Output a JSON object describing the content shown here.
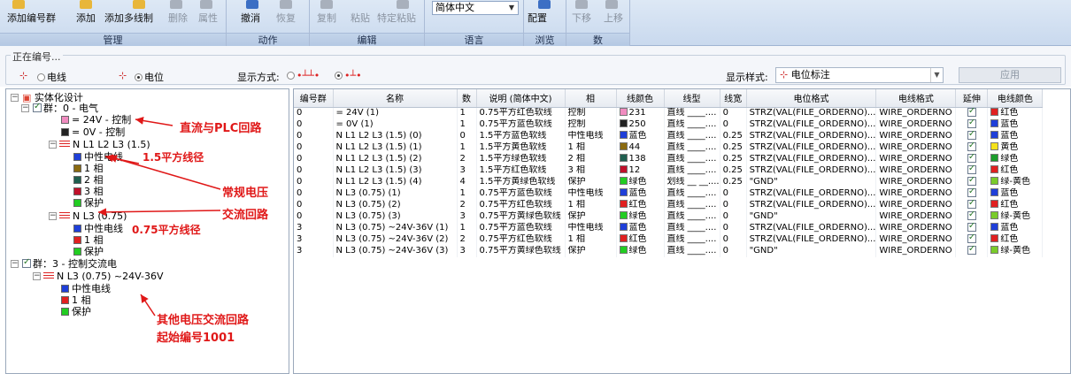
{
  "ribbon": {
    "groups": [
      {
        "label": "管理"
      },
      {
        "label": "动作"
      },
      {
        "label": "编辑"
      },
      {
        "label": "语言"
      },
      {
        "label": "浏览"
      },
      {
        "label": "数"
      }
    ],
    "buttons": {
      "add_group": "添加编号群",
      "add": "添加",
      "add_multi": "添加多线制",
      "delete": "删除",
      "props": "属性",
      "undo": "撤消",
      "redo": "恢复",
      "copy": "复制",
      "paste": "粘贴",
      "special_paste": "特定粘贴",
      "config": "配置",
      "move_down": "下移",
      "move_up": "上移"
    },
    "language_value": "简体中文"
  },
  "options": {
    "legend": "正在编号...",
    "radio_wire": "电线",
    "radio_potential": "电位",
    "display_mode_label": "显示方式:",
    "display_style_label": "显示样式:",
    "display_style_value": "电位标注",
    "apply": "应用"
  },
  "tree": {
    "root": "实体化设计",
    "g0": "群：0 - 电气",
    "p24": "= 24V - 控制",
    "p0": "= 0V - 控制",
    "l15": "N L1 L2 L3 (1.5)",
    "l15_n": "中性电线",
    "l15_1": "1 相",
    "l15_2": "2 相",
    "l15_3": "3 相",
    "l15_pe": "保护",
    "l075": "N L3 (0.75)",
    "l075_n": "中性电线",
    "l075_1": "1 相",
    "l075_pe": "保护",
    "g3": "群：3 - 控制交流电",
    "l3": "N L3 (0.75) ~24V-36V",
    "l3_n": "中性电线",
    "l3_1": "1 相",
    "l3_pe": "保护"
  },
  "annotations": {
    "a1": "直流与PLC回路",
    "a2": "1.5平方线径",
    "a3": "常规电压",
    "a4": "交流回路",
    "a5": "0.75平方线径",
    "a6": "其他电压交流回路",
    "a7": "起始编号1001"
  },
  "table": {
    "columns": [
      "编号群",
      "名称",
      "数",
      "说明 (简体中文)",
      "相",
      "线颜色",
      "线型",
      "线宽",
      "电位格式",
      "电线格式",
      "延伸",
      "电线颜色"
    ],
    "rows": [
      {
        "g": "0",
        "name": "= 24V (1)",
        "n": "1",
        "desc": "0.75平方红色软线",
        "phase": "控制",
        "wc": "231",
        "wcc": "#f08cc0",
        "lt": "直线 ____....",
        "lw": "0",
        "pf": "STRZ(VAL(FILE_ORDERNO)...",
        "wf": "WIRE_ORDERNO",
        "ext": true,
        "col": "红色",
        "colc": "#e02020"
      },
      {
        "g": "0",
        "name": "= 0V (1)",
        "n": "1",
        "desc": "0.75平方蓝色软线",
        "phase": "控制",
        "wc": "250",
        "wcc": "#222222",
        "lt": "直线 ____....",
        "lw": "0",
        "pf": "STRZ(VAL(FILE_ORDERNO)...",
        "wf": "WIRE_ORDERNO",
        "ext": true,
        "col": "蓝色",
        "colc": "#1f3fd8"
      },
      {
        "g": "0",
        "name": "N L1 L2 L3 (1.5) (0)",
        "n": "0",
        "desc": "1.5平方蓝色软线",
        "phase": "中性电线",
        "wc": "蓝色",
        "wcc": "#1f3fd8",
        "lt": "直线 ____....",
        "lw": "0.25",
        "pf": "STRZ(VAL(FILE_ORDERNO)...",
        "wf": "WIRE_ORDERNO",
        "ext": true,
        "col": "蓝色",
        "colc": "#1f3fd8"
      },
      {
        "g": "0",
        "name": "N L1 L2 L3 (1.5) (1)",
        "n": "1",
        "desc": "1.5平方黄色软线",
        "phase": "1 相",
        "wc": "44",
        "wcc": "#8a6a10",
        "lt": "直线 ____....",
        "lw": "0.25",
        "pf": "STRZ(VAL(FILE_ORDERNO)...",
        "wf": "WIRE_ORDERNO",
        "ext": true,
        "col": "黄色",
        "colc": "#f5e21a"
      },
      {
        "g": "0",
        "name": "N L1 L2 L3 (1.5) (2)",
        "n": "2",
        "desc": "1.5平方绿色软线",
        "phase": "2 相",
        "wc": "138",
        "wcc": "#1f5e4f",
        "lt": "直线 ____....",
        "lw": "0.25",
        "pf": "STRZ(VAL(FILE_ORDERNO)...",
        "wf": "WIRE_ORDERNO",
        "ext": true,
        "col": "绿色",
        "colc": "#1c9c2c"
      },
      {
        "g": "0",
        "name": "N L1 L2 L3 (1.5) (3)",
        "n": "3",
        "desc": "1.5平方红色软线",
        "phase": "3 相",
        "wc": "12",
        "wcc": "#c0102a",
        "lt": "直线 ____....",
        "lw": "0.25",
        "pf": "STRZ(VAL(FILE_ORDERNO)...",
        "wf": "WIRE_ORDERNO",
        "ext": true,
        "col": "红色",
        "colc": "#e02020"
      },
      {
        "g": "0",
        "name": "N L1 L2 L3 (1.5) (4)",
        "n": "4",
        "desc": "1.5平方黄绿色软线",
        "phase": "保护",
        "wc": "绿色",
        "wcc": "#22cc22",
        "lt": "划线 __ __....",
        "lw": "0.25",
        "pf": "\"GND\"",
        "wf": "WIRE_ORDERNO",
        "ext": true,
        "col": "绿-黄色",
        "colc": "#7acb2a"
      },
      {
        "g": "0",
        "name": "N L3 (0.75)  (1)",
        "n": "1",
        "desc": "0.75平方蓝色软线",
        "phase": "中性电线",
        "wc": "蓝色",
        "wcc": "#1f3fd8",
        "lt": "直线 ____....",
        "lw": "0",
        "pf": "STRZ(VAL(FILE_ORDERNO)...",
        "wf": "WIRE_ORDERNO",
        "ext": true,
        "col": "蓝色",
        "colc": "#1f3fd8"
      },
      {
        "g": "0",
        "name": "N L3 (0.75)  (2)",
        "n": "2",
        "desc": "0.75平方红色软线",
        "phase": "1 相",
        "wc": "红色",
        "wcc": "#e02020",
        "lt": "直线 ____....",
        "lw": "0",
        "pf": "STRZ(VAL(FILE_ORDERNO)...",
        "wf": "WIRE_ORDERNO",
        "ext": true,
        "col": "红色",
        "colc": "#e02020"
      },
      {
        "g": "0",
        "name": "N L3 (0.75)  (3)",
        "n": "3",
        "desc": "0.75平方黄绿色软线",
        "phase": "保护",
        "wc": "绿色",
        "wcc": "#22cc22",
        "lt": "直线 ____....",
        "lw": "0",
        "pf": "\"GND\"",
        "wf": "WIRE_ORDERNO",
        "ext": true,
        "col": "绿-黄色",
        "colc": "#7acb2a"
      },
      {
        "g": "3",
        "name": "N L3 (0.75) ~24V-36V (1)",
        "n": "1",
        "desc": "0.75平方蓝色软线",
        "phase": "中性电线",
        "wc": "蓝色",
        "wcc": "#1f3fd8",
        "lt": "直线 ____....",
        "lw": "0",
        "pf": "STRZ(VAL(FILE_ORDERNO)...",
        "wf": "WIRE_ORDERNO",
        "ext": true,
        "col": "蓝色",
        "colc": "#1f3fd8"
      },
      {
        "g": "3",
        "name": "N L3 (0.75) ~24V-36V (2)",
        "n": "2",
        "desc": "0.75平方红色软线",
        "phase": "1 相",
        "wc": "红色",
        "wcc": "#e02020",
        "lt": "直线 ____....",
        "lw": "0",
        "pf": "STRZ(VAL(FILE_ORDERNO)...",
        "wf": "WIRE_ORDERNO",
        "ext": true,
        "col": "红色",
        "colc": "#e02020"
      },
      {
        "g": "3",
        "name": "N L3 (0.75) ~24V-36V (3)",
        "n": "3",
        "desc": "0.75平方黄绿色软线",
        "phase": "保护",
        "wc": "绿色",
        "wcc": "#22cc22",
        "lt": "直线 ____....",
        "lw": "0",
        "pf": "\"GND\"",
        "wf": "WIRE_ORDERNO",
        "ext": true,
        "col": "绿-黄色",
        "colc": "#7acb2a"
      }
    ]
  }
}
